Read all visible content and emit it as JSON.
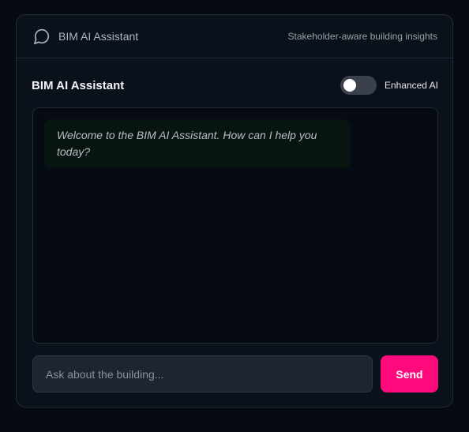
{
  "header": {
    "icon": "chat-bubble-icon",
    "title": "BIM AI Assistant",
    "subtitle": "Stakeholder-aware building insights"
  },
  "panel": {
    "title": "BIM AI Assistant",
    "toggle": {
      "label": "Enhanced AI",
      "enabled": false
    }
  },
  "messages": [
    {
      "role": "assistant",
      "text": "Welcome to the BIM AI Assistant. How can I help you today?"
    }
  ],
  "composer": {
    "placeholder": "Ask about the building...",
    "value": "",
    "send_label": "Send"
  },
  "colors": {
    "accent": "#ff0a7c",
    "background": "#060a12",
    "card": "#0b111b",
    "assistant_bubble": "#07140f"
  }
}
